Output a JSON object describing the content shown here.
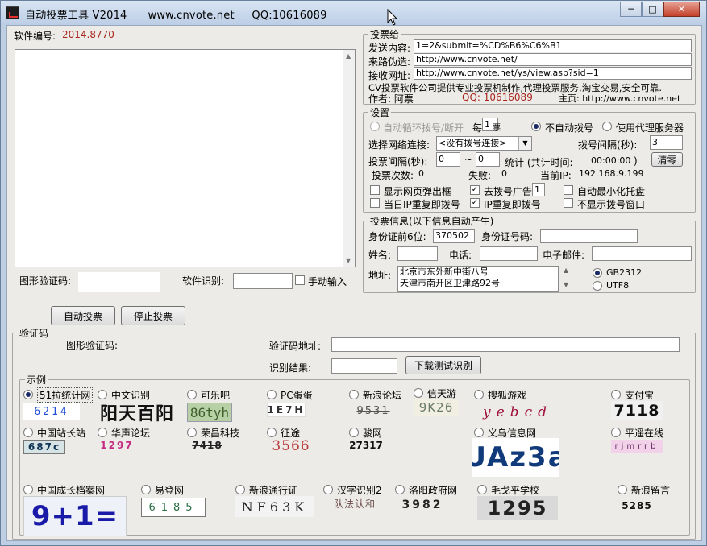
{
  "window": {
    "title": "自动投票工具 V2014      www.cnvote.net     QQ:10616089",
    "minimize": "─",
    "maximize": "□",
    "close": "✕"
  },
  "software": {
    "id_label": "软件编号:",
    "id_value": "2014.8770"
  },
  "captcha_row": {
    "image_label": "图形验证码:",
    "recognize_label": "软件识别:",
    "manual_label": "手动输入"
  },
  "buttons": {
    "start": "自动投票",
    "stop": "停止投票",
    "clear": "清零",
    "download_test": "下载测试识别"
  },
  "vote": {
    "group_title": "投票给",
    "send_label": "发送内容:",
    "send_value": "1=2&submit=%CD%B6%C6%B1",
    "referer_label": "来路伪造:",
    "referer_value": "http://www.cnvote.net/",
    "receive_label": "接收网址:",
    "receive_value": "http://www.cnvote.net/ys/view.asp?sid=1",
    "company_line": "CV投票软件公司提供专业投票机制作,代理投票服务,淘宝交易,安全可靠.",
    "author_label": "作者: 阿票",
    "qq_text": "QQ: 10616089",
    "homepage_text": "主页: http://www.cnvote.net"
  },
  "settings": {
    "group_title": "设置",
    "auto_dial": "自动循环拨号/断开",
    "every_label": "每",
    "every_value": "1",
    "every_suffix": "票",
    "no_dial": "不自动拨号",
    "use_proxy": "使用代理服务器",
    "network_label": "选择网络连接:",
    "network_value": "<没有拨号连接>",
    "dial_interval_label": "拨号间隔(秒):",
    "dial_interval_value": "3",
    "vote_interval_label": "投票间隔(秒):",
    "vote_interval_min": "0",
    "tilde": "~",
    "vote_interval_max": "0",
    "stats_label": "统计 (共计时间:",
    "stats_time": "00:00:00",
    "stats_close": ")",
    "votes_label": "投票次数:",
    "votes_value": "0",
    "fail_label": "失败:",
    "fail_value": "0",
    "ip_label": "当前IP:",
    "ip_value": "192.168.9.199",
    "show_popup": "显示网页弹出框",
    "remove_ad": "去拨号广告",
    "remove_ad_value": "1",
    "auto_minimize": "自动最小化托盘",
    "dup_ip_dial_now": "当日IP重复即拨号",
    "ip_dup_dial": "IP重复即拨号",
    "hide_dial_window": "不显示拨号窗口"
  },
  "info": {
    "group_title": "投票信息(以下信息自动产生)",
    "id6_label": "身份证前6位:",
    "id6_value": "370502",
    "id_label": "身份证号码:",
    "name_label": "姓名:",
    "phone_label": "电话:",
    "email_label": "电子邮件:",
    "address_label": "地址:",
    "address_line1": "北京市东外新中街八号",
    "address_line2": "天津市南开区卫津路92号",
    "gb2312": "GB2312",
    "utf8": "UTF8"
  },
  "captcha_group": {
    "title": "验证码",
    "image_label": "图形验证码:",
    "address_label": "验证码地址:",
    "result_label": "识别结果:"
  },
  "examples": {
    "title": "示例",
    "items": [
      {
        "label": "51拉统计网",
        "code": "6214",
        "selected": true
      },
      {
        "label": "中文识别",
        "code": "阳天百阳"
      },
      {
        "label": "可乐吧",
        "code": "86tyh"
      },
      {
        "label": "PC蛋蛋",
        "code": "1E7H"
      },
      {
        "label": "新浪论坛",
        "code": "9531"
      },
      {
        "label": "信天游",
        "code": "9K26"
      },
      {
        "label": "搜狐游戏",
        "code": "yebcd"
      },
      {
        "label": "支付宝",
        "code": "7118"
      },
      {
        "label": "中国站长站",
        "code": "687c"
      },
      {
        "label": "华声论坛",
        "code": "1297"
      },
      {
        "label": "荣昌科技",
        "code": "7418"
      },
      {
        "label": "征途",
        "code": "3566"
      },
      {
        "label": "骏网",
        "code": "27317"
      },
      {
        "label": "义乌信息网",
        "code": "UAz3a"
      },
      {
        "label": "平遥在线",
        "code": "rjmrrb"
      },
      {
        "label": "中国成长档案网",
        "code": "9+1="
      },
      {
        "label": "易登网",
        "code": "6185"
      },
      {
        "label": "新浪通行证",
        "code": "NF63K"
      },
      {
        "label": "汉字识别2",
        "code": "队法认和"
      },
      {
        "label": "洛阳政府网",
        "code": "3982"
      },
      {
        "label": "毛戈平学校",
        "code": "1295"
      },
      {
        "label": "新浪留言",
        "code": "5285"
      }
    ]
  },
  "colors": {
    "accent_red": "#a8261e",
    "selection_dark": "#1a2a66"
  }
}
